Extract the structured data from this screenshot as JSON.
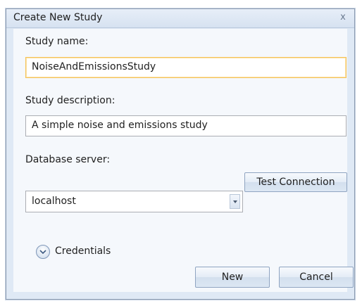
{
  "dialog": {
    "title": "Create New Study",
    "close_label": "x"
  },
  "form": {
    "study_name_label": "Study name:",
    "study_name_value": "NoiseAndEmissionsStudy",
    "study_description_label": "Study description:",
    "study_description_value": "A simple noise and emissions study",
    "database_server_label": "Database server:",
    "database_server_value": "localhost",
    "test_connection_label": "Test Connection",
    "credentials_label": "Credentials"
  },
  "footer": {
    "new_label": "New",
    "cancel_label": "Cancel"
  },
  "icons": {
    "close": "close-icon",
    "dropdown": "chevron-down-icon",
    "expander": "expand-circle-icon"
  },
  "colors": {
    "focus_border": "#f5c35a",
    "dialog_background": "#dfe9f5",
    "button_border": "#8fa4c1"
  }
}
